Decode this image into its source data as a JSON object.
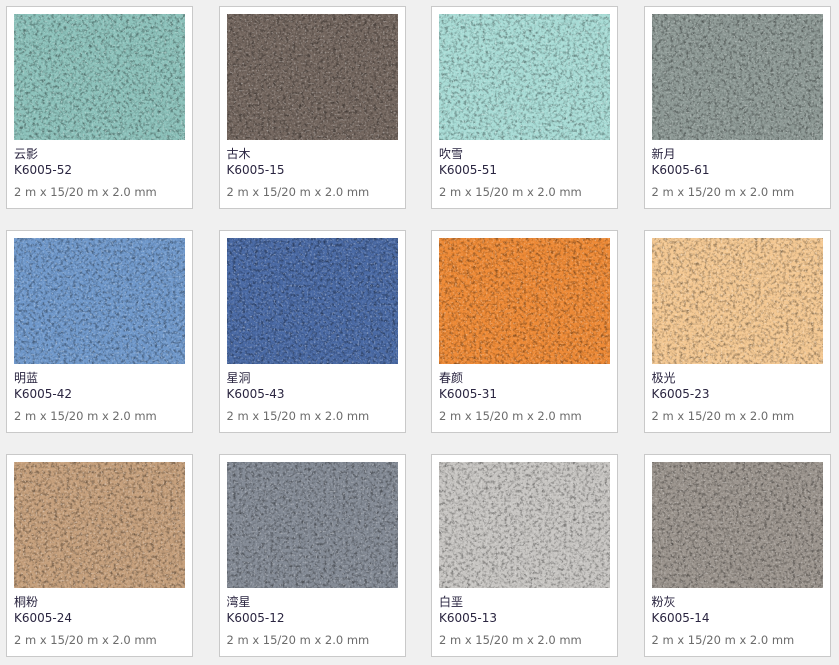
{
  "products": [
    {
      "name": "云影",
      "code": "K6005-52",
      "size": "2 m x 15/20 m x 2.0 mm",
      "color": "#8cc2bb"
    },
    {
      "name": "古木",
      "code": "K6005-15",
      "size": "2 m x 15/20 m x 2.0 mm",
      "color": "#74675f"
    },
    {
      "name": "吹雪",
      "code": "K6005-51",
      "size": "2 m x 15/20 m x 2.0 mm",
      "color": "#a8dcd6"
    },
    {
      "name": "新月",
      "code": "K6005-61",
      "size": "2 m x 15/20 m x 2.0 mm",
      "color": "#8e9a96"
    },
    {
      "name": "明蓝",
      "code": "K6005-42",
      "size": "2 m x 15/20 m x 2.0 mm",
      "color": "#7099cc"
    },
    {
      "name": "星洞",
      "code": "K6005-43",
      "size": "2 m x 15/20 m x 2.0 mm",
      "color": "#4a6aa5"
    },
    {
      "name": "春颜",
      "code": "K6005-31",
      "size": "2 m x 15/20 m x 2.0 mm",
      "color": "#ee8a36"
    },
    {
      "name": "极光",
      "code": "K6005-23",
      "size": "2 m x 15/20 m x 2.0 mm",
      "color": "#f4c892"
    },
    {
      "name": "桐粉",
      "code": "K6005-24",
      "size": "2 m x 15/20 m x 2.0 mm",
      "color": "#c6a07c"
    },
    {
      "name": "湾星",
      "code": "K6005-12",
      "size": "2 m x 15/20 m x 2.0 mm",
      "color": "#848b96"
    },
    {
      "name": "白垩",
      "code": "K6005-13",
      "size": "2 m x 15/20 m x 2.0 mm",
      "color": "#c8c6c3"
    },
    {
      "name": "粉灰",
      "code": "K6005-14",
      "size": "2 m x 15/20 m x 2.0 mm",
      "color": "#9c958e"
    }
  ]
}
